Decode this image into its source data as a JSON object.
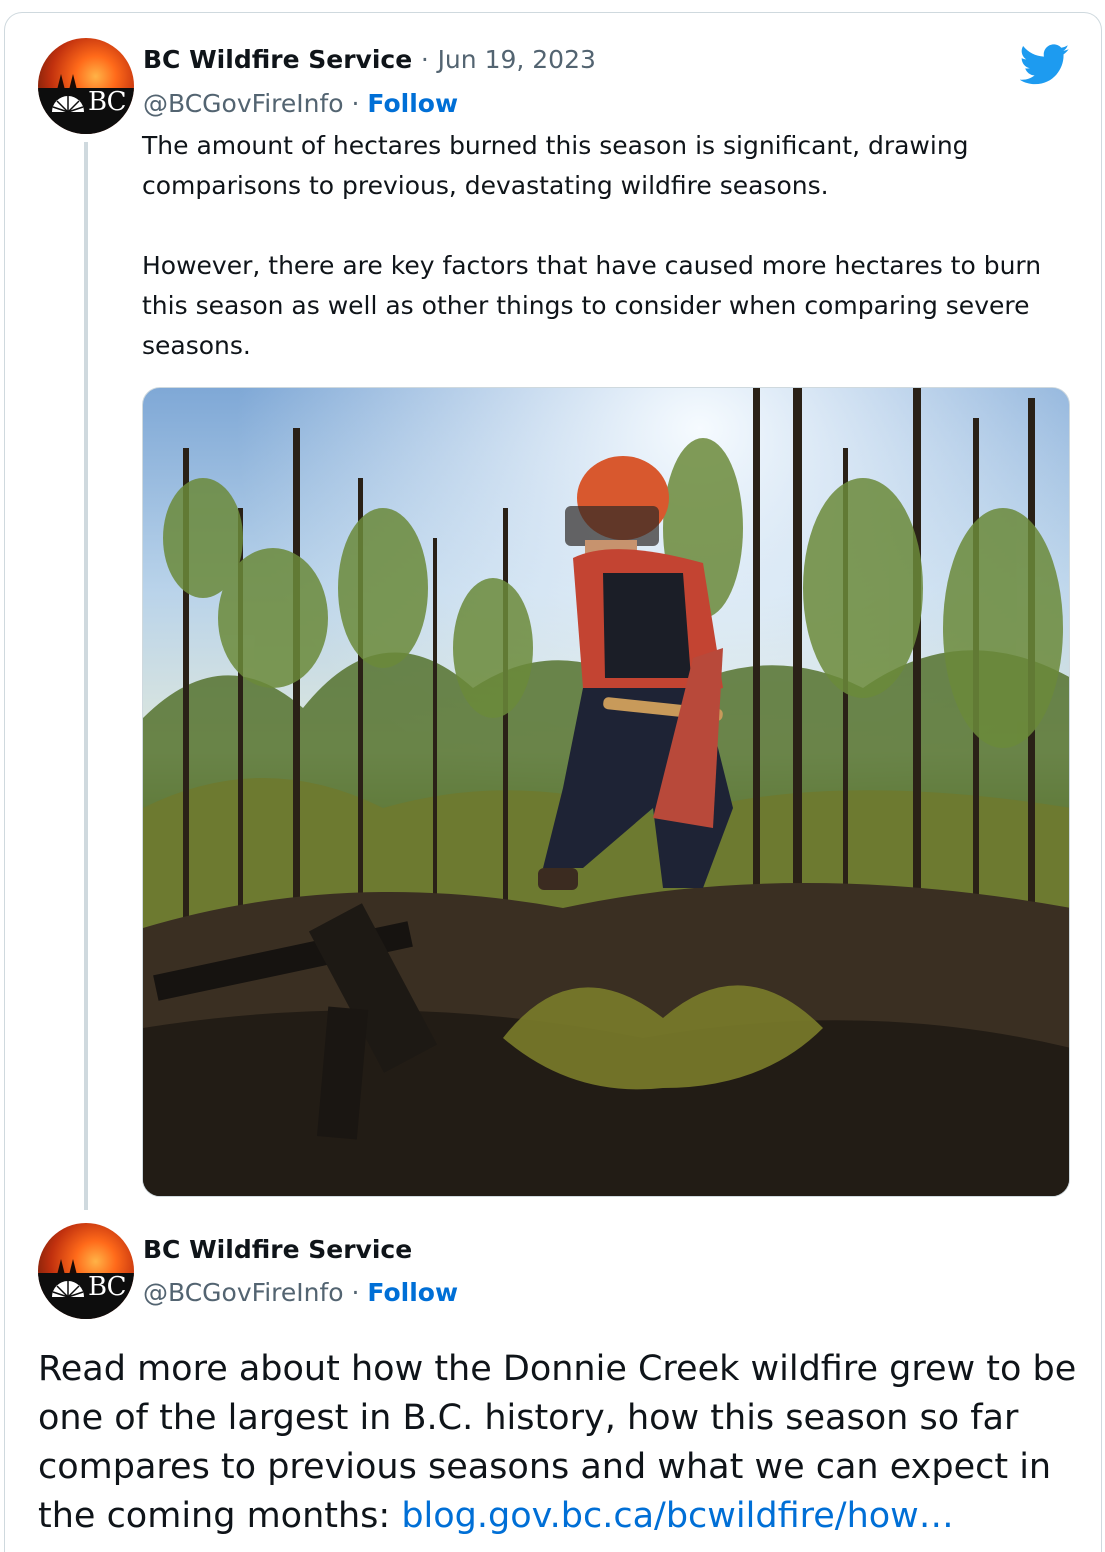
{
  "tweet1": {
    "display_name": "BC Wildfire Service",
    "separator": "·",
    "date": "Jun 19, 2023",
    "handle": "@BCGovFireInfo",
    "follow_label": "Follow",
    "avatar_text": "BC",
    "paragraph1": "The amount of hectares burned this season is significant, drawing comparisons to previous, devastating wildfire seasons.",
    "paragraph2": "However, there are key factors that have caused more hectares to burn this season as well as other things to consider when comparing severe seasons.",
    "photo_icon": "wildfire-crew-photo"
  },
  "tweet2": {
    "display_name": "BC Wildfire Service",
    "separator": "·",
    "handle": "@BCGovFireInfo",
    "follow_label": "Follow",
    "avatar_text": "BC",
    "body_text": "Read more about how the Donnie Creek wildfire grew to be one of the largest in B.C. history, how this season so far compares to previous seasons and what we can expect in the coming months: ",
    "link_text": "blog.gov.bc.ca/bcwildfire/how…"
  },
  "icons": {
    "brand": "twitter-bird-icon"
  },
  "colors": {
    "link": "#006fd6",
    "twitter_blue": "#1d9bf0",
    "text": "#0f1419",
    "secondary": "#536471",
    "border": "#cfd9de"
  }
}
